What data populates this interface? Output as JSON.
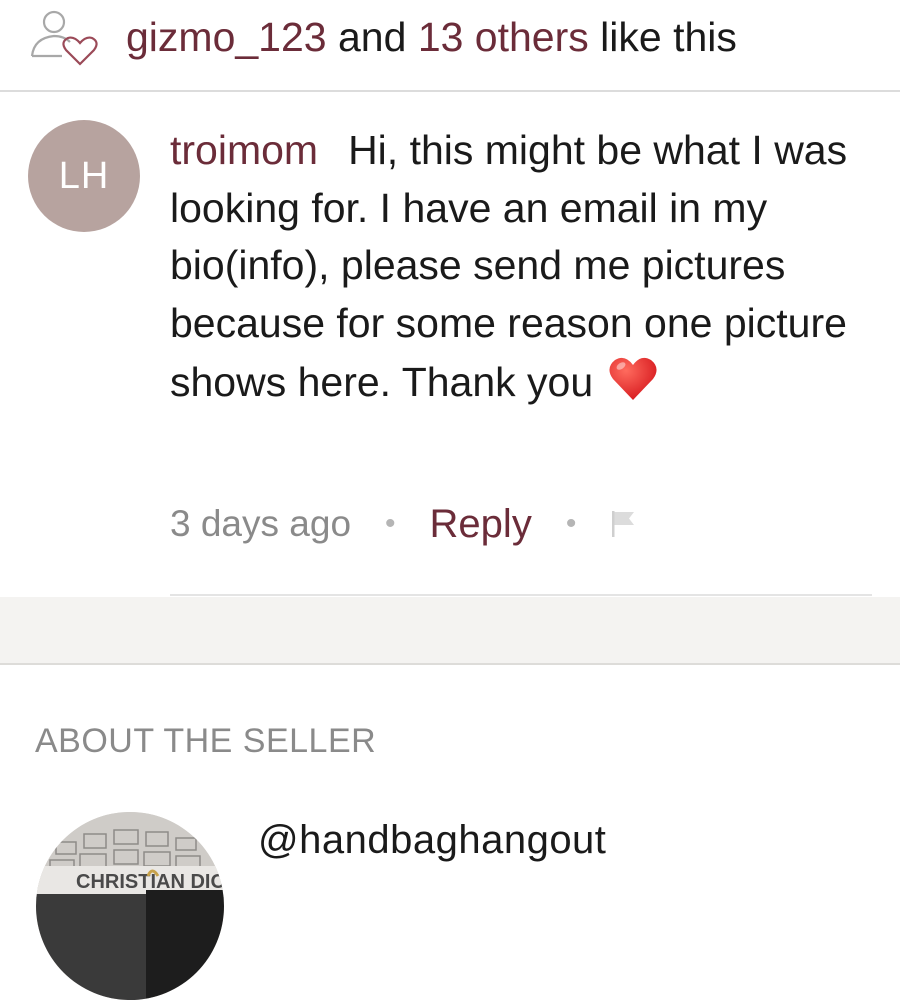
{
  "likes": {
    "icon": "people-heart-icon",
    "first_liker": "gizmo_123",
    "connector": "and",
    "others_link": "13 others",
    "suffix": "like this"
  },
  "comment": {
    "avatar_initials": "LH",
    "author": "troimom",
    "text": "Hi, this might be what I was looking for. I have an email in my bio(info), please send me pictures because for some reason one picture shows here. Thank you",
    "emoji": "red-heart-emoji",
    "time": "3 days ago",
    "separator": "•",
    "reply_label": "Reply",
    "flag_icon": "flag-icon"
  },
  "about": {
    "heading": "ABOUT THE SELLER",
    "seller_handle": "@handbaghangout",
    "seller_avatar_text": "CHRISTIAN DIOR"
  },
  "colors": {
    "accent": "#6b2c39",
    "avatar_bg": "#b7a39f",
    "muted": "#8a8a8a",
    "band": "#f4f3f1"
  }
}
